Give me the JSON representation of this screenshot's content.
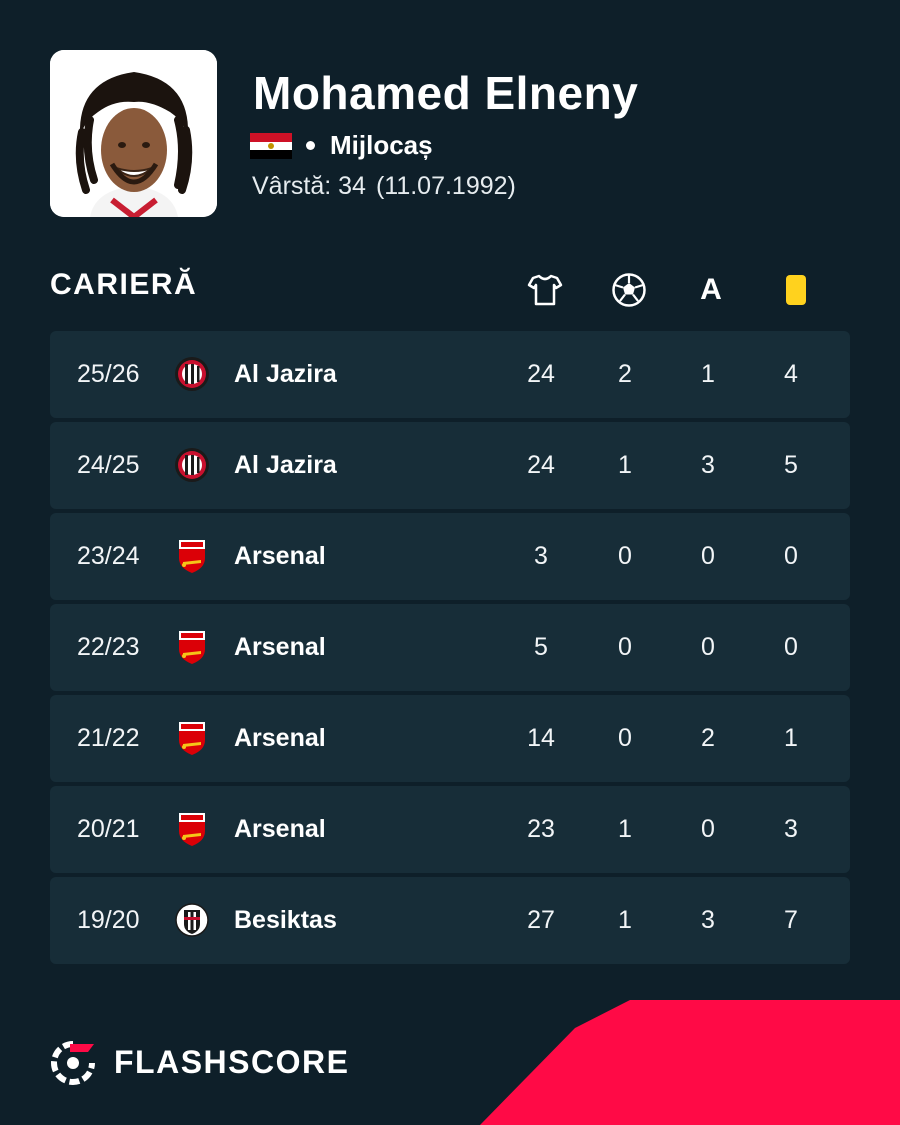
{
  "player": {
    "name": "Mohamed Elneny",
    "flag_colors": [
      "#ce1126",
      "#ffffff",
      "#000000"
    ],
    "position": "Mijlocaș",
    "age_label": "Vârstă: 34",
    "birthdate": "(11.07.1992)"
  },
  "career": {
    "title": "CARIERĂ",
    "columns": [
      {
        "icon": "shirt-icon"
      },
      {
        "icon": "ball-icon"
      },
      {
        "icon": "assist-icon",
        "label": "A"
      },
      {
        "icon": "yellow-card-icon",
        "color": "#ffd21e"
      }
    ],
    "rows": [
      {
        "season": "25/26",
        "team": "Al Jazira",
        "crest": "al-jazira-crest-icon",
        "apps": "24",
        "goals": "2",
        "assists": "1",
        "yellow": "4"
      },
      {
        "season": "24/25",
        "team": "Al Jazira",
        "crest": "al-jazira-crest-icon",
        "apps": "24",
        "goals": "1",
        "assists": "3",
        "yellow": "5"
      },
      {
        "season": "23/24",
        "team": "Arsenal",
        "crest": "arsenal-crest-icon",
        "apps": "3",
        "goals": "0",
        "assists": "0",
        "yellow": "0"
      },
      {
        "season": "22/23",
        "team": "Arsenal",
        "crest": "arsenal-crest-icon",
        "apps": "5",
        "goals": "0",
        "assists": "0",
        "yellow": "0"
      },
      {
        "season": "21/22",
        "team": "Arsenal",
        "crest": "arsenal-crest-icon",
        "apps": "14",
        "goals": "0",
        "assists": "2",
        "yellow": "1"
      },
      {
        "season": "20/21",
        "team": "Arsenal",
        "crest": "arsenal-crest-icon",
        "apps": "23",
        "goals": "1",
        "assists": "0",
        "yellow": "3"
      },
      {
        "season": "19/20",
        "team": "Besiktas",
        "crest": "besiktas-crest-icon",
        "apps": "27",
        "goals": "1",
        "assists": "3",
        "yellow": "7"
      }
    ]
  },
  "brand": {
    "name": "FLASHSCORE",
    "accent": "#ff0a46",
    "background": "#0e1f29",
    "row_background": "#172d38"
  }
}
